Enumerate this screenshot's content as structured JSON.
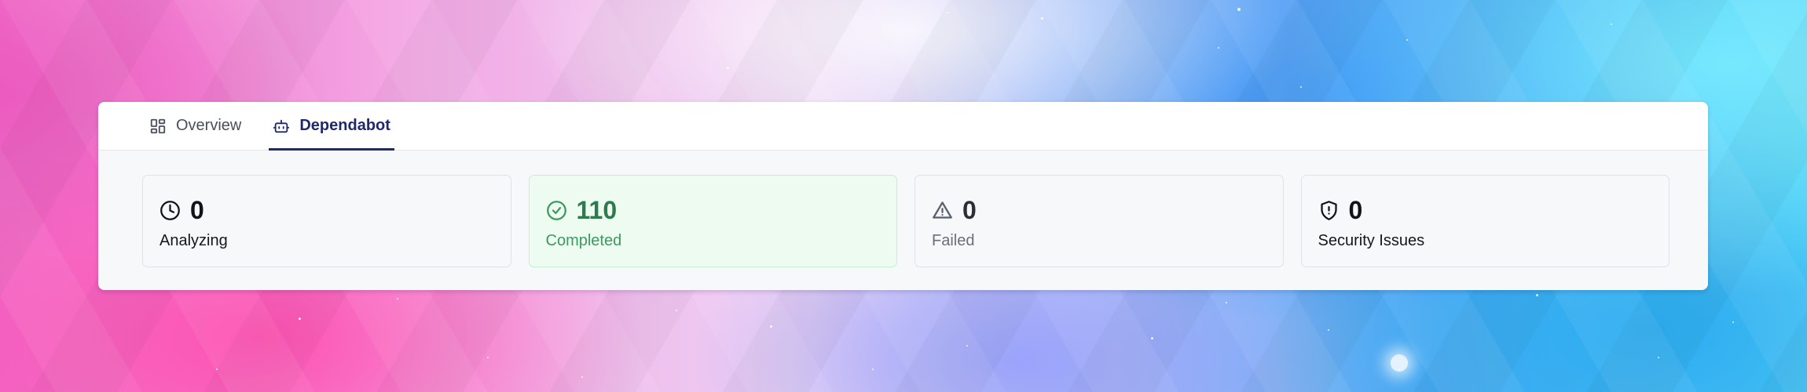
{
  "tabs": [
    {
      "label": "Overview",
      "icon": "dashboard-grid-icon",
      "active": false
    },
    {
      "label": "Dependabot",
      "icon": "robot-icon",
      "active": true
    }
  ],
  "stats": [
    {
      "icon": "clock-icon",
      "value": "0",
      "label": "Analyzing",
      "status": "neutral"
    },
    {
      "icon": "check-circle-icon",
      "value": "110",
      "label": "Completed",
      "status": "success"
    },
    {
      "icon": "warning-triangle-icon",
      "value": "0",
      "label": "Failed",
      "status": "muted"
    },
    {
      "icon": "shield-alert-icon",
      "value": "0",
      "label": "Security Issues",
      "status": "neutral"
    }
  ],
  "colors": {
    "active_tab": "#1f2a6b",
    "success_text": "#2b7b4d",
    "success_bg": "#eefbf1",
    "muted_text": "#6a6f7b"
  }
}
